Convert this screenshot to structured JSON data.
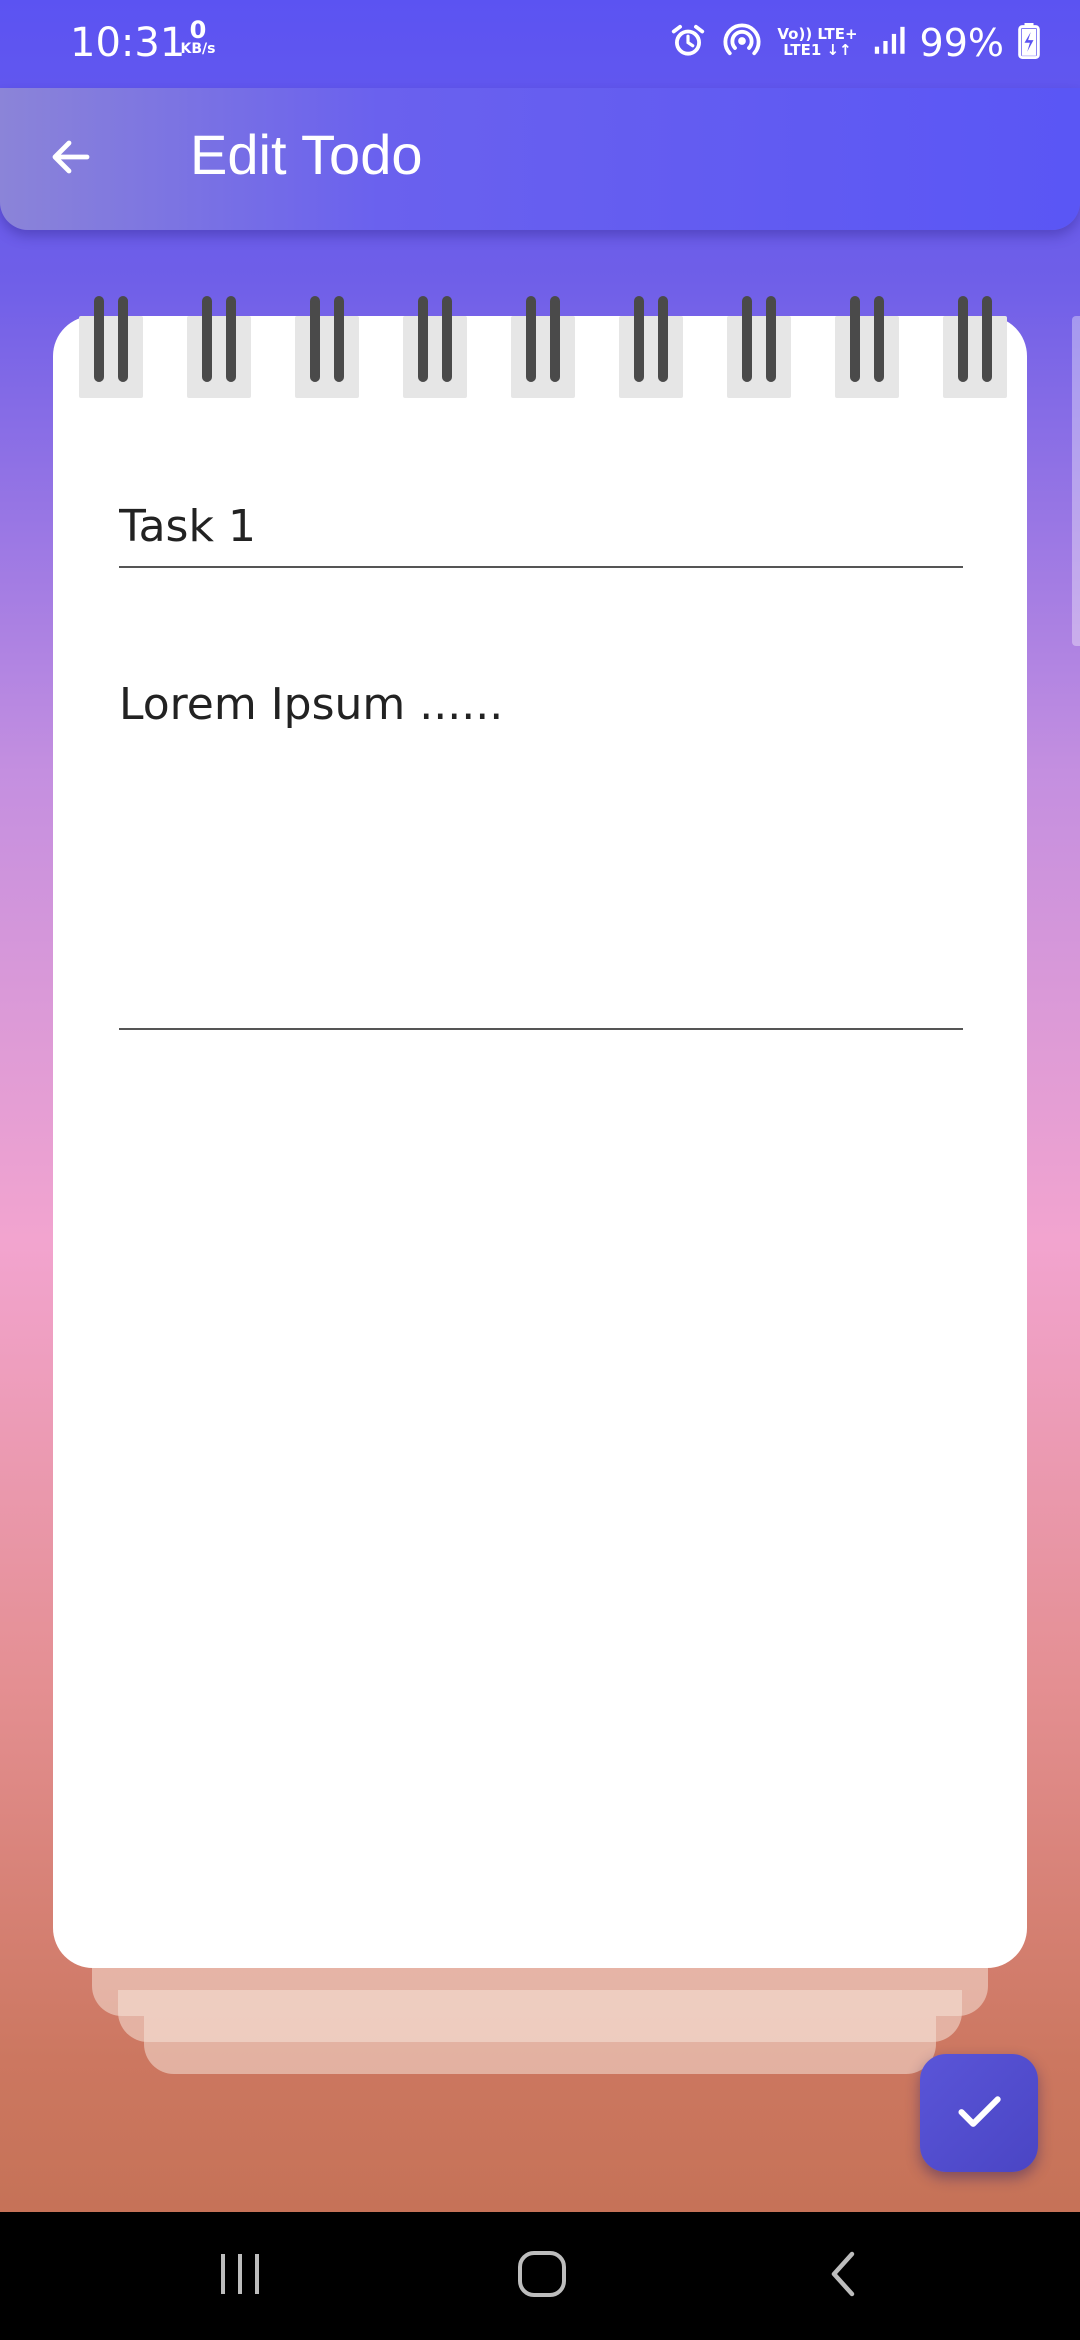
{
  "status_bar": {
    "time": "10:31",
    "data_rate_value": "0",
    "data_rate_unit": "KB/s",
    "network_line1": "Vo)) LTE+",
    "network_line2": "LTE1 ↓↑",
    "battery": "99%"
  },
  "app_bar": {
    "title": "Edit Todo",
    "back_icon": "arrow-back-icon"
  },
  "note": {
    "title_value": "Task 1",
    "description_value": "Lorem Ipsum ......",
    "ring_count": 9
  },
  "fab": {
    "icon": "check-icon",
    "color": "#5a55d8"
  },
  "nav_bar": {
    "recents_icon": "recents-icon",
    "home_icon": "home-icon",
    "back_icon": "back-icon"
  },
  "colors": {
    "appbar": "#5a56f5",
    "ring": "#4a4a4a",
    "ring_holder": "#e6e6e6"
  }
}
